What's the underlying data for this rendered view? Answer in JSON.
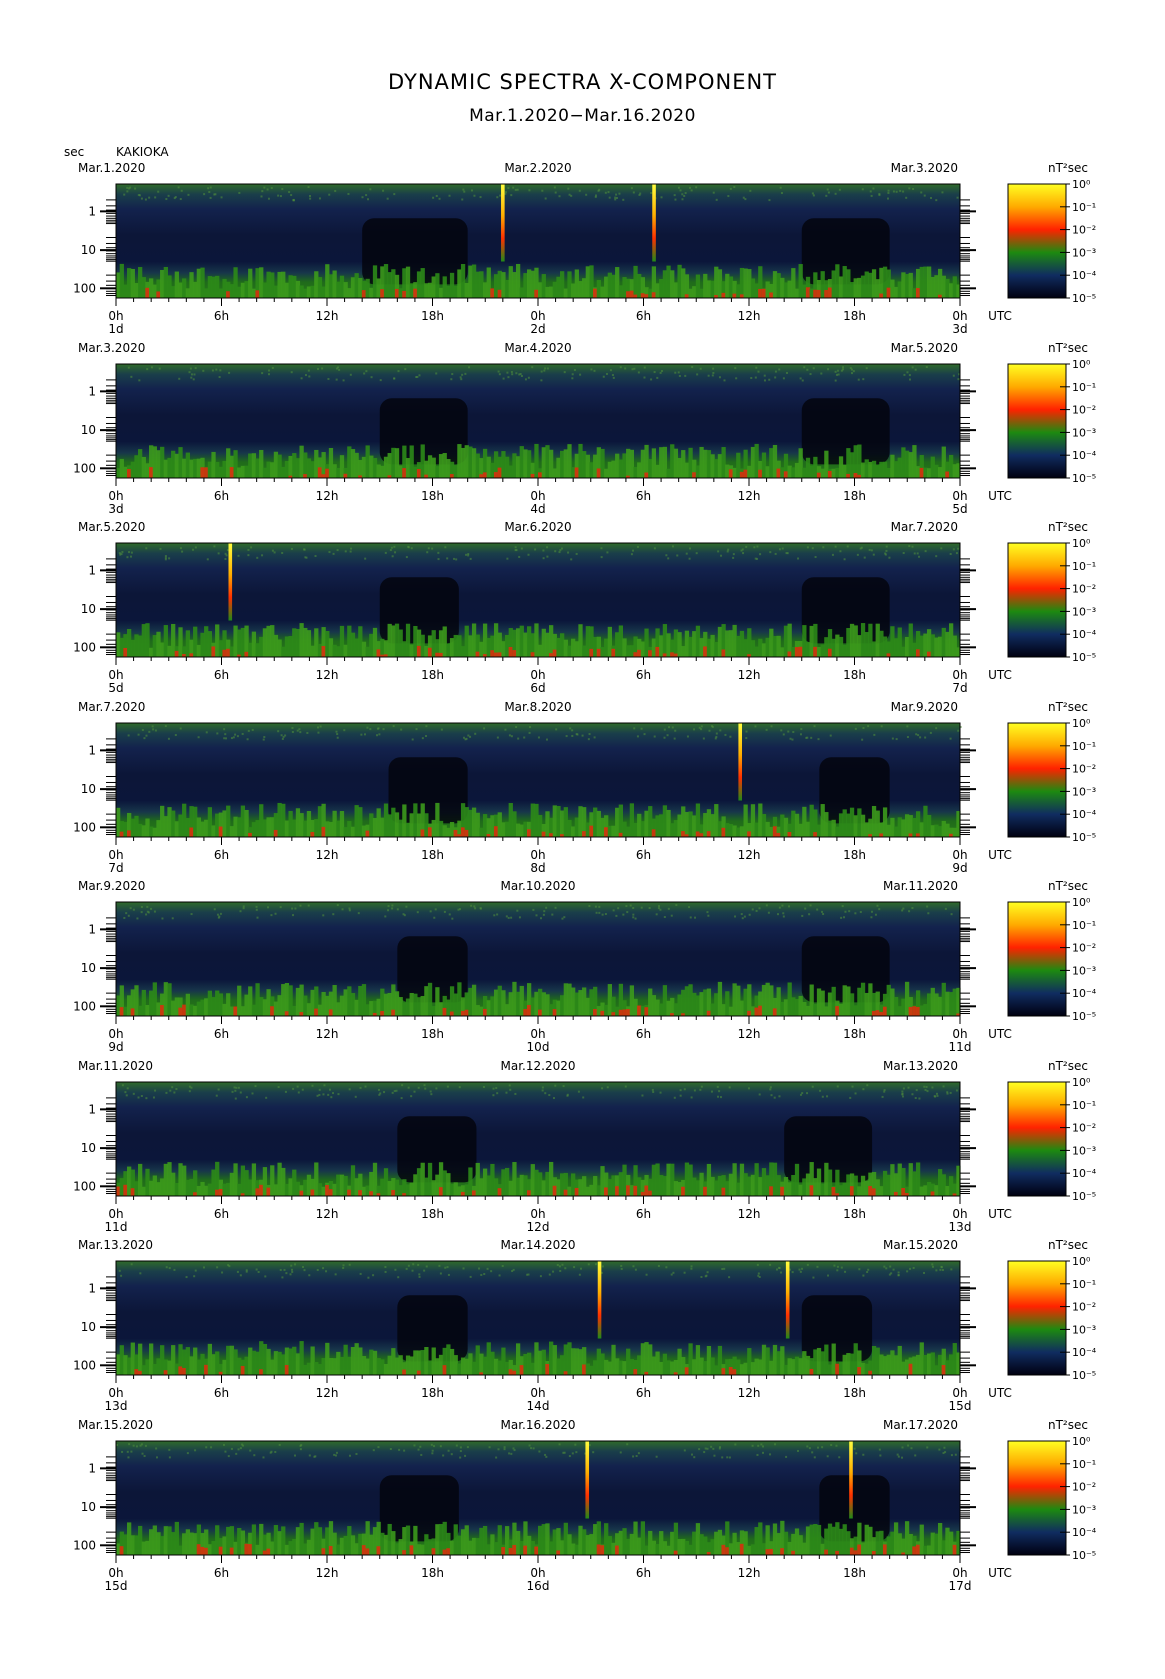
{
  "title": "DYNAMIC SPECTRA X-COMPONENT",
  "subtitle": "Mar.1.2020−Mar.16.2020",
  "y_unit_label": "sec",
  "station": "KAKIOKA",
  "colorbar_unit": "nT²sec",
  "utc_label": "UTC",
  "chart_data": {
    "type": "heatmap",
    "y_scale": "log",
    "y_axis": {
      "ticks": [
        "1",
        "10",
        "100"
      ],
      "unit": "sec"
    },
    "x_ticks": [
      "0h",
      "6h",
      "12h",
      "18h",
      "0h",
      "6h",
      "12h",
      "18h",
      "0h"
    ],
    "colorbar": {
      "scale": "log",
      "ticks": [
        "10⁰",
        "10⁻¹",
        "10⁻²",
        "10⁻³",
        "10⁻⁴",
        "10⁻⁵"
      ],
      "colors": [
        "#ffff22",
        "#ffaa00",
        "#ff2200",
        "#1d8a10",
        "#102c60",
        "#000010"
      ]
    },
    "panels": [
      {
        "left_date": "Mar.1.2020",
        "mid_date": "Mar.2.2020",
        "right_date": "Mar.3.2020",
        "day_labels": [
          "1d",
          "2d",
          "3d"
        ],
        "spikes_hours": [
          22.0,
          30.6
        ],
        "quiet_hours": [
          [
            14,
            20
          ],
          [
            39,
            44
          ]
        ]
      },
      {
        "left_date": "Mar.3.2020",
        "mid_date": "Mar.4.2020",
        "right_date": "Mar.5.2020",
        "day_labels": [
          "3d",
          "4d",
          "5d"
        ],
        "spikes_hours": [],
        "quiet_hours": [
          [
            15,
            20
          ],
          [
            39,
            44
          ]
        ]
      },
      {
        "left_date": "Mar.5.2020",
        "mid_date": "Mar.6.2020",
        "right_date": "Mar.7.2020",
        "day_labels": [
          "5d",
          "6d",
          "7d"
        ],
        "spikes_hours": [
          6.5
        ],
        "quiet_hours": [
          [
            15,
            19.5
          ],
          [
            39,
            44
          ]
        ]
      },
      {
        "left_date": "Mar.7.2020",
        "mid_date": "Mar.8.2020",
        "right_date": "Mar.9.2020",
        "day_labels": [
          "7d",
          "8d",
          "9d"
        ],
        "spikes_hours": [
          35.5
        ],
        "quiet_hours": [
          [
            15.5,
            20
          ],
          [
            40,
            44
          ]
        ]
      },
      {
        "left_date": "Mar.9.2020",
        "mid_date": "Mar.10.2020",
        "right_date": "Mar.11.2020",
        "day_labels": [
          "9d",
          "10d",
          "11d"
        ],
        "spikes_hours": [],
        "quiet_hours": [
          [
            16,
            20
          ],
          [
            39,
            44
          ]
        ]
      },
      {
        "left_date": "Mar.11.2020",
        "mid_date": "Mar.12.2020",
        "right_date": "Mar.13.2020",
        "day_labels": [
          "11d",
          "12d",
          "13d"
        ],
        "spikes_hours": [],
        "quiet_hours": [
          [
            16,
            20.5
          ],
          [
            38,
            43
          ]
        ]
      },
      {
        "left_date": "Mar.13.2020",
        "mid_date": "Mar.14.2020",
        "right_date": "Mar.15.2020",
        "day_labels": [
          "13d",
          "14d",
          "15d"
        ],
        "spikes_hours": [
          27.5,
          38.2
        ],
        "quiet_hours": [
          [
            16,
            20
          ],
          [
            39,
            43
          ]
        ]
      },
      {
        "left_date": "Mar.15.2020",
        "mid_date": "Mar.16.2020",
        "right_date": "Mar.17.2020",
        "day_labels": [
          "15d",
          "16d",
          "17d"
        ],
        "spikes_hours": [
          26.8,
          41.8
        ],
        "quiet_hours": [
          [
            15,
            19.5
          ],
          [
            40,
            44
          ]
        ]
      }
    ]
  }
}
